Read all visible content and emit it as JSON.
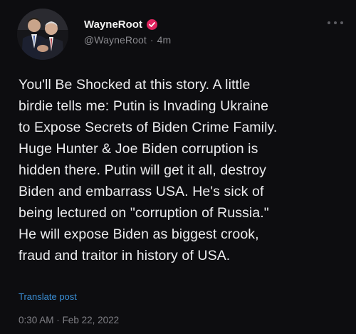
{
  "author": {
    "display_name": "WayneRoot",
    "handle": "@WayneRoot",
    "age": "4m",
    "verified_icon": "verified-badge-icon"
  },
  "tweet": {
    "text": "You'll Be Shocked at this story. A little\nbirdie tells me: Putin is Invading Ukraine\nto Expose Secrets of Biden Crime Family.\nHuge Hunter & Joe Biden corruption is\nhidden there. Putin will get it all, destroy\nBiden and embarrass USA. He's sick of\nbeing lectured on \"corruption of Russia.\"\nHe will expose Biden as biggest crook,\nfraud and traitor in history of USA."
  },
  "translate_label": "Translate post",
  "timestamp": {
    "time": "0:30 AM",
    "separator": "·",
    "date": "Feb 22, 2022"
  },
  "header_separator": "·",
  "colors": {
    "background": "#0d0d10",
    "text": "#ececee",
    "muted": "#808086",
    "link": "#3a8fd6",
    "badge": "#e0245e"
  }
}
